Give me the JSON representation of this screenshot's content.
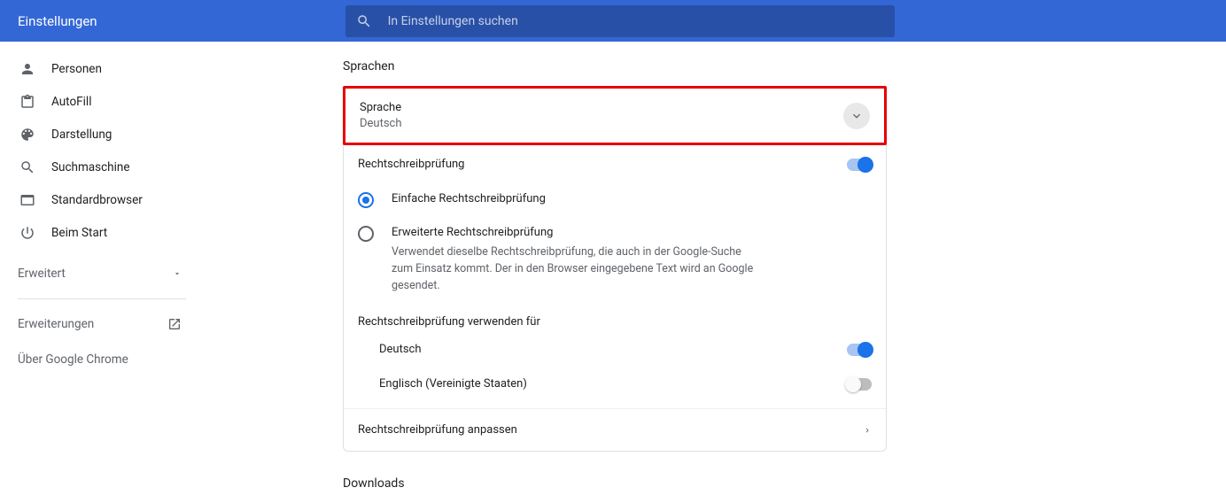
{
  "header": {
    "title": "Einstellungen",
    "search_placeholder": "In Einstellungen suchen"
  },
  "sidebar": {
    "items": [
      {
        "label": "Personen"
      },
      {
        "label": "AutoFill"
      },
      {
        "label": "Darstellung"
      },
      {
        "label": "Suchmaschine"
      },
      {
        "label": "Standardbrowser"
      },
      {
        "label": "Beim Start"
      }
    ],
    "advanced": "Erweitert",
    "extensions": "Erweiterungen",
    "about": "Über Google Chrome"
  },
  "main": {
    "section_title": "Sprachen",
    "language": {
      "label": "Sprache",
      "value": "Deutsch"
    },
    "spellcheck": {
      "title": "Rechtschreibprüfung",
      "enabled": true,
      "options": [
        {
          "label": "Einfache Rechtschreibprüfung",
          "selected": true
        },
        {
          "label": "Erweiterte Rechtschreibprüfung",
          "selected": false,
          "desc": "Verwendet dieselbe Rechtschreibprüfung, die auch in der Google-Suche zum Einsatz kommt. Der in den Browser eingegebene Text wird an Google gesendet."
        }
      ],
      "use_for_title": "Rechtschreibprüfung verwenden für",
      "languages": [
        {
          "label": "Deutsch",
          "enabled": true
        },
        {
          "label": "Englisch (Vereinigte Staaten)",
          "enabled": false
        }
      ],
      "customize": "Rechtschreibprüfung anpassen"
    },
    "downloads_title": "Downloads"
  }
}
